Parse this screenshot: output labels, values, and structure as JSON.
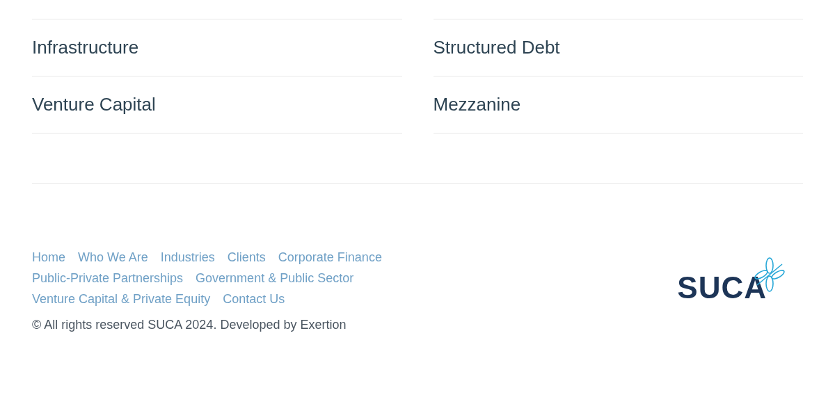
{
  "sectors": [
    {
      "label": "Infrastructure"
    },
    {
      "label": "Structured Debt"
    },
    {
      "label": "Venture Capital"
    },
    {
      "label": "Mezzanine"
    }
  ],
  "footer": {
    "links": [
      "Home",
      "Who We Are",
      "Industries",
      "Clients",
      "Corporate Finance",
      "Public-Private Partnerships",
      "Government & Public Sector",
      "Venture Capital & Private Equity",
      "Contact Us"
    ],
    "copyright": "© All rights reserved SUCA 2024. Developed by Exertion",
    "logo": "SUCA"
  }
}
